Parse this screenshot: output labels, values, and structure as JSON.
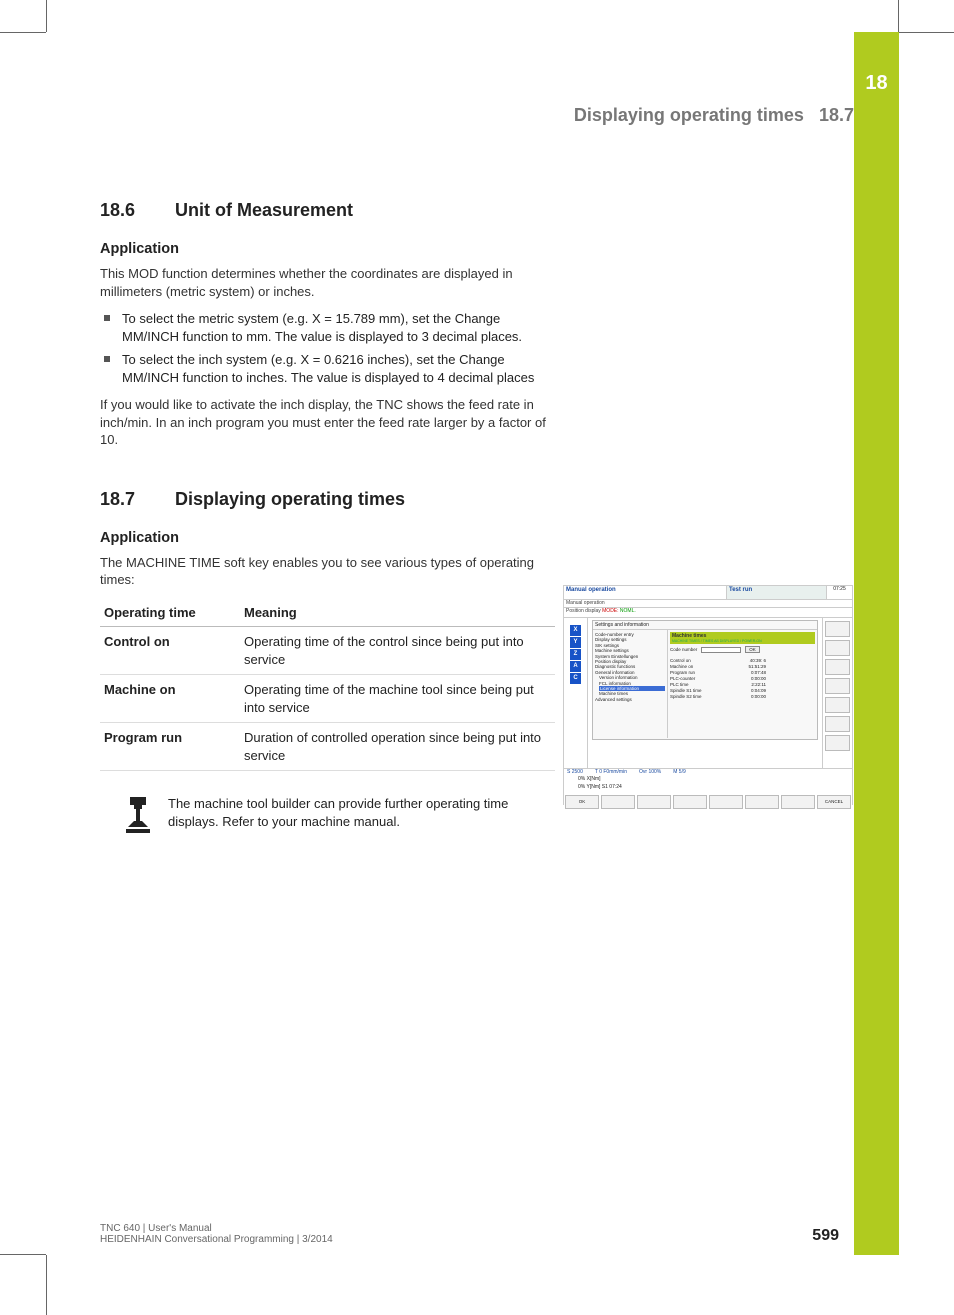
{
  "greenbar": {
    "chapter": "18"
  },
  "header": {
    "title": "Displaying operating times",
    "section": "18.7"
  },
  "sec186": {
    "num": "18.6",
    "title": "Unit of Measurement",
    "sub": "Application",
    "p1": "This MOD function determines whether the coordinates are displayed in millimeters (metric system) or inches.",
    "b1": "To select the metric system (e.g. X = 15.789 mm), set the Change MM/INCH function to mm. The value is displayed to 3 decimal places.",
    "b2": "To select the inch system (e.g. X = 0.6216 inches), set the Change MM/INCH function to inches. The value is displayed to 4 decimal places",
    "p2": "If you would like to activate the inch display, the TNC shows the feed rate in inch/min. In an inch program you must enter the feed rate larger by a factor of 10."
  },
  "sec187": {
    "num": "18.7",
    "title": "Displaying operating times",
    "sub": "Application",
    "p1": "The MACHINE TIME soft key enables you to see various types of operating times:",
    "th1": "Operating time",
    "th2": "Meaning",
    "rows": [
      {
        "k": "Control on",
        "v": "Operating time of the control since being put into service"
      },
      {
        "k": "Machine on",
        "v": "Operating time of the machine tool since being put into service"
      },
      {
        "k": "Program run",
        "v": "Duration of controlled operation since being put into service"
      }
    ],
    "note": "The machine tool builder can provide further operating time displays. Refer to your machine manual."
  },
  "shot": {
    "tb_left": "Manual operation",
    "tb_left_sub": "Manual operation",
    "tb_right": "Test run",
    "clock": "07:25",
    "posline_pre": "Position display ",
    "posline_mode": "MODE: ",
    "posline_val": "NOML.",
    "axes": [
      "X",
      "Y",
      "Z",
      "A",
      "C"
    ],
    "dlg_title": "Settings and information",
    "tree": {
      "items": [
        "Code-number entry",
        "Display settings",
        "SIK settings",
        "Machine settings",
        "System Einstellungen",
        "Position display",
        "Diagnostic functions",
        "General information",
        "Version information",
        "FCL information",
        "License information",
        "Machine times",
        "Advanced settings"
      ],
      "highlight": "License information"
    },
    "panel": {
      "title": "Machine times",
      "subtitle": "MACHINE TIMES / TIMES AS DISPLAYED / POWER-ON",
      "code_label": "Code number",
      "ok": "OK",
      "kv": [
        {
          "k": "Control on",
          "v": "40:39: 6"
        },
        {
          "k": "Machine on",
          "v": "51:51:29"
        },
        {
          "k": "Program run",
          "v": "0:07:48"
        },
        {
          "k": "PLC-counter",
          "v": "0:00:00"
        },
        {
          "k": "PLC time",
          "v": "2:22:11"
        },
        {
          "k": "Spindle S1 time",
          "v": "0:04:09"
        },
        {
          "k": "Spindle S2 time",
          "v": "0:00:00"
        }
      ]
    },
    "stat1": {
      "left": "S 2500",
      "mid": "T    0  F0mm/min",
      "ovr": "Ovr 100%",
      "m": "M 5/9"
    },
    "x_line": "0%  X[Nm]",
    "y_line": "0%  Y[Nm]  S1   07:24",
    "btn_left": "OK",
    "btn_right": "CANCEL"
  },
  "footer": {
    "line1": "TNC 640 | User's Manual",
    "line2": "HEIDENHAIN Conversational Programming | 3/2014",
    "page": "599"
  }
}
